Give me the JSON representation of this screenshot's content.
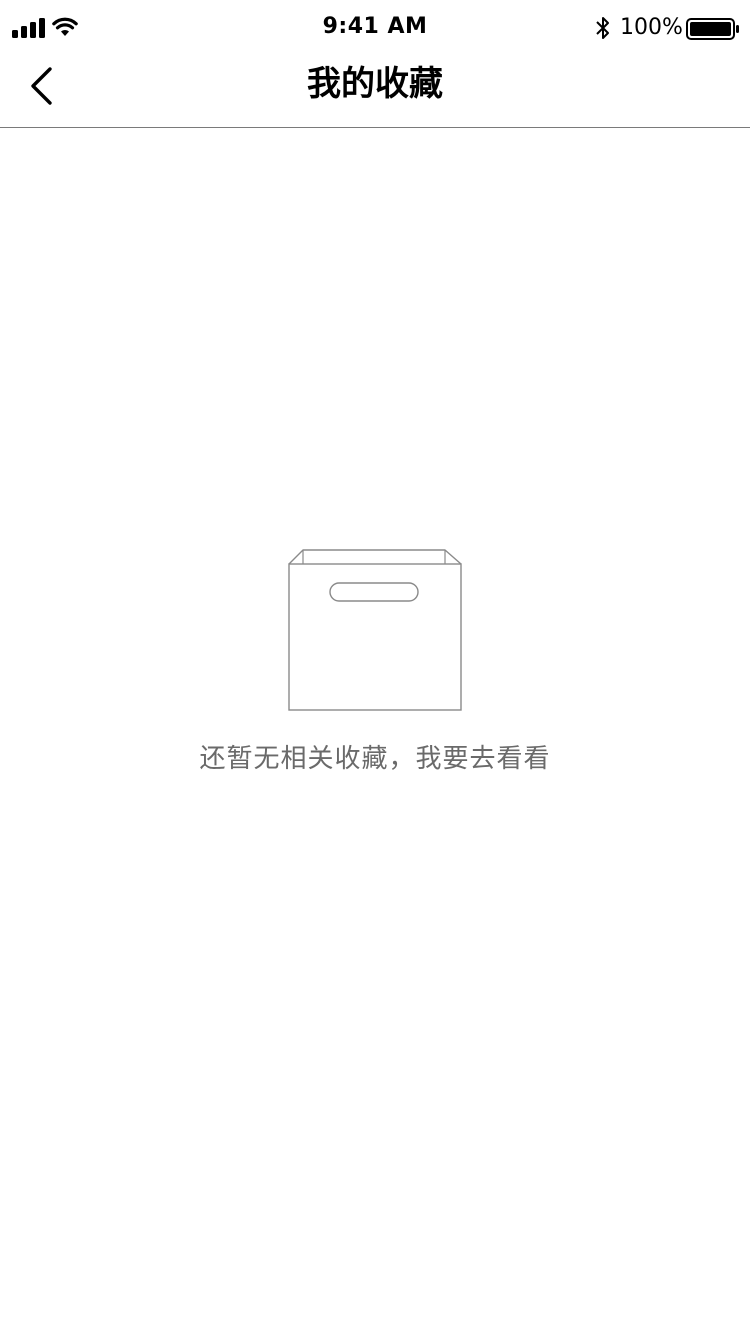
{
  "status_bar": {
    "time": "9:41 AM",
    "battery_percent": "100%",
    "icons": [
      "signal-icon",
      "wifi-icon",
      "bluetooth-icon",
      "battery-icon"
    ]
  },
  "nav": {
    "title": "我的收藏",
    "back_icon": "chevron-left-icon"
  },
  "empty_state": {
    "illustration_icon": "empty-box-icon",
    "message": "还暂无相关收藏，我要去看看"
  },
  "colors": {
    "background": "#ffffff",
    "text_primary": "#000000",
    "text_secondary": "#6a6a6a",
    "divider": "#7a7a7a",
    "illustration_stroke": "#8a8a8a"
  }
}
